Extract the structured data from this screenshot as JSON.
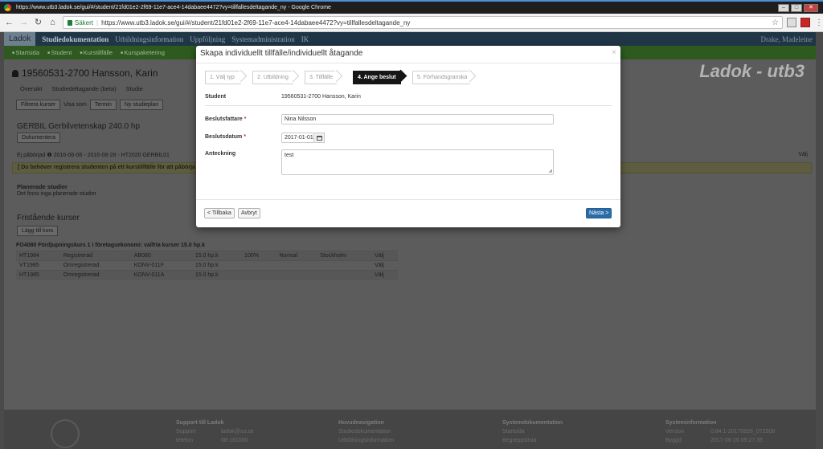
{
  "browser": {
    "window_title": "https://www.utb3.ladok.se/gui/#/student/21fd01e2-2f69-11e7-ace4-14dabaee4472?vy=tillfallesdeltagande_ny - Google Chrome",
    "secure_label": "Säkert",
    "url": "https://www.utb3.ladok.se/gui/#/student/21fd01e2-2f69-11e7-ace4-14dabaee4472?vy=tillfallesdeltagande_ny"
  },
  "app": {
    "brand": "Ladok",
    "top_nav": [
      "Studiedokumentation",
      "Utbildningsinformation",
      "Uppföljning",
      "Systemadministration",
      "IK"
    ],
    "user": "Drake, Madeleine",
    "sub_nav": [
      "Startsida",
      "Student",
      "Kurstillfälle",
      "Kurspaketering"
    ],
    "watermark": "Ladok - utb3"
  },
  "student": {
    "header": "19560531-2700 Hansson, Karin",
    "tabs": [
      "Översikt",
      "Studiedeltagande (beta)",
      "Studie"
    ],
    "filter_button": "Filtrera kurser",
    "visa_som": "Visa som",
    "termin_button": "Termin",
    "studyplan_button": "Ny studieplan",
    "programme": "GERBIL Gerbilvetenskap 240.0 hp",
    "doc_button": "Dokumentera",
    "status_line": "Ej påbörjad ❶ 2016-06-06 - 2016-08-28 - HT2020 GERBIL01",
    "valj": "Välj",
    "warning": "[ Du behöver registrera studenten på ett kurstillfälle för att påbörja",
    "planned_heading": "Planerade studier",
    "planned_text": "Det finns inga planerade studier",
    "fristaende_heading": "Fristående kurser",
    "add_course_button": "Lägg till kurs",
    "course_title": "FO4080 Fördjupningskurs 1 i företagsekonomi: valfria kurser 15.0 hp.k",
    "course_rows": [
      [
        "HT1984",
        "Registrerad",
        "AB080",
        "15.0 hp.k",
        "100%",
        "Normal",
        "Stockholm",
        "Välj"
      ],
      [
        "VT1985",
        "Omregistrerad",
        "KONV-011F",
        "15.0 hp.k",
        "",
        "",
        "",
        "Välj"
      ],
      [
        "HT1985",
        "Omregistrerad",
        "KONV-011A",
        "15.0 hp.k",
        "",
        "",
        "",
        "Välj"
      ]
    ]
  },
  "footer": {
    "support_heading": "Support till Ladok",
    "support_rows": [
      [
        "Support",
        "ladok@su.se"
      ],
      [
        "telefon",
        "08-161000"
      ]
    ],
    "nav_heading": "Huvudnavigation",
    "nav_items": [
      "Studiedokumentation",
      "Utbildningsinformation"
    ],
    "doc_heading": "Systemdokumentation",
    "doc_items": [
      "Startsida",
      "Begreppslista"
    ],
    "info_heading": "Systeminformation",
    "info_rows": [
      [
        "Version",
        "0.84.1-20170626_072508"
      ],
      [
        "Byggd",
        "2017-06-26 09:27:35"
      ]
    ]
  },
  "modal": {
    "title": "Skapa individuellt tillfälle/individuellt åtagande",
    "close": "×",
    "steps": [
      "1. Välj typ",
      "2. Utbildning",
      "3. Tillfälle",
      "4. Ange beslut",
      "5. Förhandsgranska"
    ],
    "active_step": 3,
    "student_label": "Student",
    "student_value": "19560531-2700 Hansson, Karin",
    "beslutsfattare_label": "Beslutsfattare",
    "beslutsfattare_value": "Nina Nilsson",
    "beslutsdatum_label": "Beslutsdatum",
    "beslutsdatum_value": "2017-01-01",
    "anteckning_label": "Anteckning",
    "anteckning_value": "test",
    "required_mark": "*",
    "back_button": "< Tillbaka",
    "cancel_button": "Avbryt",
    "next_button": "Nästa >"
  }
}
